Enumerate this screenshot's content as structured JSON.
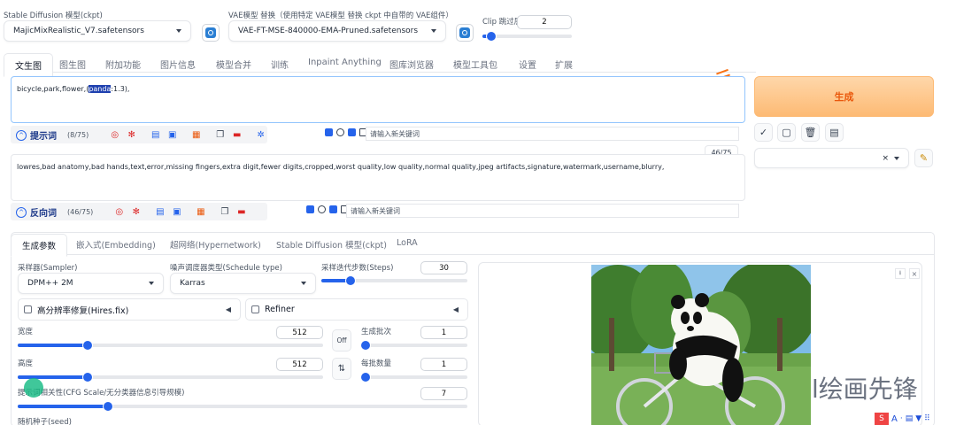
{
  "top": {
    "ckpt_label": "Stable Diffusion 模型(ckpt)",
    "ckpt_value": "MajicMixRealistic_V7.safetensors",
    "vae_label": "VAE模型 替换（使用特定 VAE模型 替换 ckpt 中自带的 VAE组件）",
    "vae_value": "VAE-FT-MSE-840000-EMA-Pruned.safetensors",
    "clip_label": "Clip 跳过层",
    "clip_value": "2",
    "clip_fraction": 0.1
  },
  "tabs": [
    "文生图",
    "图生图",
    "附加功能",
    "图片信息",
    "模型合并",
    "训练",
    "Inpaint Anything",
    "图库浏览器",
    "模型工具包",
    "设置",
    "扩展"
  ],
  "prompt": {
    "text_before": "bicycle,park,flower,(",
    "text_selected": "panda",
    "text_after": ":1.3),",
    "label": "提示词",
    "count": "(8/75)",
    "kw_placeholder": "请输入新关键词"
  },
  "negative": {
    "text": "lowres,bad anatomy,bad hands,text,error,missing fingers,extra digit,fewer digits,cropped,worst quality,low quality,normal quality,jpeg artifacts,signature,watermark,username,blurry,",
    "label": "反向词",
    "count": "(46/75)",
    "badge": "46/75",
    "kw_placeholder": "请输入新关键词"
  },
  "generate": {
    "label": "生成",
    "color": "#fdba74"
  },
  "style_select_value": "",
  "subtabs": [
    "生成参数",
    "嵌入式(Embedding)",
    "超网络(Hypernetwork)",
    "Stable Diffusion 模型(ckpt)",
    "LoRA"
  ],
  "params": {
    "sampler_label": "采样器(Sampler)",
    "sampler_value": "DPM++ 2M",
    "schedule_label": "噪声调度器类型(Schedule type)",
    "schedule_value": "Karras",
    "steps_label": "采样迭代步数(Steps)",
    "steps_value": "30",
    "steps_fraction": 0.2,
    "hires_label": "高分辨率修复(Hires.fix)",
    "refiner_label": "Refiner",
    "width_label": "宽度",
    "width_value": "512",
    "width_fraction": 0.23,
    "height_label": "高度",
    "height_value": "512",
    "height_fraction": 0.23,
    "swap_off": "Off",
    "batch_count_label": "生成批次",
    "batch_count_value": "1",
    "batch_size_label": "每批数量",
    "batch_size_value": "1",
    "cfg_label": "提示词相关性(CFG Scale/无分类器信息引导规模)",
    "cfg_value": "7",
    "cfg_fraction": 0.2,
    "seed_label": "随机种子(seed)"
  },
  "watermark": "l绘画先锋",
  "colors": {
    "accent": "#2563eb",
    "generate_bg": "#fdba74",
    "generate_text": "#ea580c"
  }
}
